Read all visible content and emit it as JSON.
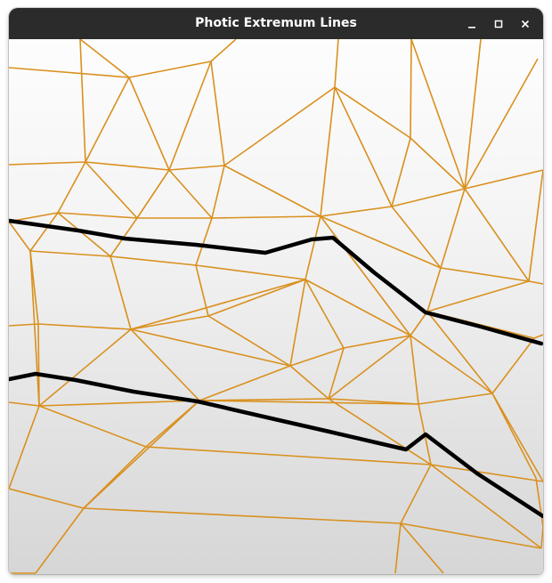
{
  "window": {
    "title": "Photic Extremum Lines",
    "controls": {
      "minimize_icon": "minimize-icon",
      "maximize_icon": "maximize-icon",
      "close_icon": "close-icon"
    }
  },
  "canvas": {
    "background_top": "#fdfdfd",
    "background_bottom": "#d6d6d6",
    "mesh_color": "#d9901e",
    "extremum_line_color": "#000000"
  }
}
